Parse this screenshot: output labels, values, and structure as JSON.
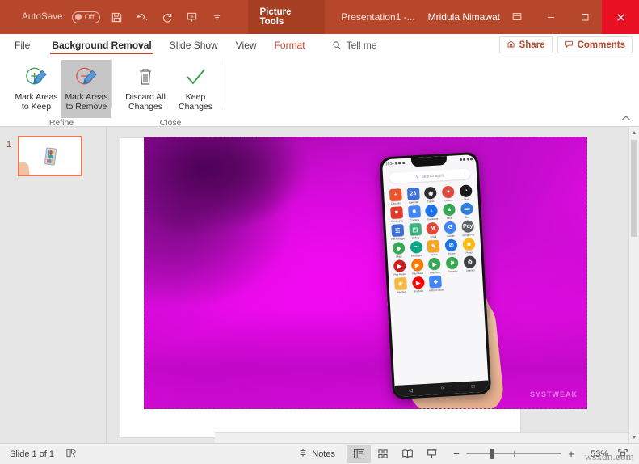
{
  "titlebar": {
    "autosave_label": "AutoSave",
    "autosave_state": "Off",
    "save_icon": "save-icon",
    "undo_icon": "undo-icon",
    "redo_icon": "redo-icon",
    "present_icon": "start-presentation-icon",
    "customize_icon": "customize-quick-access-icon",
    "context_tab": "Picture Tools",
    "document_title": "Presentation1  -...",
    "user_name": "Mridula Nimawat",
    "ribbon_display_icon": "ribbon-display-options-icon",
    "minimize_icon": "minimize-icon",
    "maximize_icon": "maximize-icon",
    "close_icon": "close-icon",
    "accent_color": "#b7472a",
    "context_tab_color": "#a63e22",
    "close_color": "#e81123"
  },
  "tabs": [
    {
      "label": "File",
      "active": false
    },
    {
      "label": "Background Removal",
      "active": true
    },
    {
      "label": "Slide Show",
      "active": false
    },
    {
      "label": "View",
      "active": false
    },
    {
      "label": "Format",
      "active": false
    }
  ],
  "tellme": {
    "label": "Tell me",
    "icon": "search-icon"
  },
  "actions": {
    "share_label": "Share",
    "share_icon": "share-icon",
    "comments_label": "Comments",
    "comments_icon": "comment-icon"
  },
  "ribbon": {
    "collapse_icon": "collapse-ribbon-chevron-icon",
    "groups": [
      {
        "name": "Refine",
        "buttons": [
          {
            "label_line1": "Mark Areas",
            "label_line2": "to Keep",
            "icon": "mark-keep-icon",
            "selected": false
          },
          {
            "label_line1": "Mark Areas",
            "label_line2": "to Remove",
            "icon": "mark-remove-icon",
            "selected": true
          }
        ]
      },
      {
        "name": "Close",
        "buttons": [
          {
            "label_line1": "Discard All",
            "label_line2": "Changes",
            "icon": "trash-icon",
            "selected": false
          },
          {
            "label_line1": "Keep",
            "label_line2": "Changes",
            "icon": "checkmark-icon",
            "selected": false
          }
        ]
      }
    ]
  },
  "thumbnails": {
    "slides": [
      {
        "number": "1",
        "selected": true
      }
    ]
  },
  "slide": {
    "picture_watermark": "SYSTWEAK",
    "removal_overlay_color": "#e60ce6",
    "selection_border": "marching-ants-dashed"
  },
  "phone": {
    "status_time": "15:34",
    "search_placeholder": "Search apps",
    "search_icon": "search-icon",
    "overflow_icon": "kebab-menu-icon",
    "apps": [
      {
        "name": "Calculator",
        "glyph": "÷",
        "color": "#e8552e",
        "shape": "sq"
      },
      {
        "name": "Calendar",
        "glyph": "23",
        "color": "#3f6fd8",
        "shape": "sq"
      },
      {
        "name": "Camera",
        "glyph": "◉",
        "color": "#2b2b2b",
        "shape": "rd"
      },
      {
        "name": "Chrome",
        "glyph": "●",
        "color": "#dd4b3e",
        "shape": "rd"
      },
      {
        "name": "Clock",
        "glyph": "◔",
        "color": "#1a1a1a",
        "shape": "rd"
      },
      {
        "name": "Community",
        "glyph": "■",
        "color": "#e4372c",
        "shape": "sq"
      },
      {
        "name": "Contacts",
        "glyph": "☻",
        "color": "#4285f4",
        "shape": "sq"
      },
      {
        "name": "Downloads",
        "glyph": "↓",
        "color": "#1a73e8",
        "shape": "rd"
      },
      {
        "name": "Drive",
        "glyph": "▲",
        "color": "#34a853",
        "shape": "rd"
      },
      {
        "name": "Duo",
        "glyph": "▬",
        "color": "#2c7fe0",
        "shape": "rd"
      },
      {
        "name": "File manager",
        "glyph": "☰",
        "color": "#3b6fd4",
        "shape": "sq"
      },
      {
        "name": "Gallery",
        "glyph": "◰",
        "color": "#3fb37f",
        "shape": "sq"
      },
      {
        "name": "Gmail",
        "glyph": "M",
        "color": "#ea4335",
        "shape": "rd"
      },
      {
        "name": "Google",
        "glyph": "G",
        "color": "#4285f4",
        "shape": "rd"
      },
      {
        "name": "Google Pay",
        "glyph": "Pay",
        "color": "#5f6368",
        "shape": "rd"
      },
      {
        "name": "Maps",
        "glyph": "◆",
        "color": "#34a853",
        "shape": "rd"
      },
      {
        "name": "Messages",
        "glyph": "•••",
        "color": "#00a884",
        "shape": "rd"
      },
      {
        "name": "Notes",
        "glyph": "✎",
        "color": "#f5a623",
        "shape": "sq"
      },
      {
        "name": "Phone",
        "glyph": "✆",
        "color": "#1a73e8",
        "shape": "rd"
      },
      {
        "name": "Photos",
        "glyph": "✵",
        "color": "#fbbc05",
        "shape": "rd"
      },
      {
        "name": "Play Movies",
        "glyph": "▶",
        "color": "#c5221f",
        "shape": "rd"
      },
      {
        "name": "Play Music",
        "glyph": "▶",
        "color": "#f57c00",
        "shape": "rd"
      },
      {
        "name": "Play Store",
        "glyph": "▶",
        "color": "#34a853",
        "shape": "rd"
      },
      {
        "name": "Recorder",
        "glyph": "⚑",
        "color": "#34a853",
        "shape": "rd"
      },
      {
        "name": "Settings",
        "glyph": "⚙",
        "color": "#3c4043",
        "shape": "rd"
      },
      {
        "name": "Weather",
        "glyph": "☀",
        "color": "#f5b942",
        "shape": "sq"
      },
      {
        "name": "YouTube",
        "glyph": "▶",
        "color": "#ff0000",
        "shape": "rd"
      },
      {
        "name": "Android Cloud",
        "glyph": "❖",
        "color": "#4285f4",
        "shape": "sq"
      }
    ],
    "nav": {
      "back_icon": "nav-back-icon",
      "home_icon": "nav-home-icon",
      "recents_icon": "nav-recents-icon"
    }
  },
  "statusbar": {
    "slide_count_text": "Slide 1 of 1",
    "accessibility_icon": "accessibility-checker-icon",
    "notes_label": "Notes",
    "notes_icon": "notes-icon",
    "views": [
      {
        "name": "Normal",
        "icon": "normal-view-icon",
        "active": true
      },
      {
        "name": "Slide Sorter",
        "icon": "slide-sorter-icon",
        "active": false
      },
      {
        "name": "Reading View",
        "icon": "reading-view-icon",
        "active": false
      },
      {
        "name": "Slide Show",
        "icon": "slide-show-icon",
        "active": false
      }
    ],
    "zoom_out_label": "−",
    "zoom_in_label": "+",
    "zoom_percent": "53%",
    "fit_icon": "fit-slide-to-window-icon",
    "watermark": "wsxdn.com"
  }
}
